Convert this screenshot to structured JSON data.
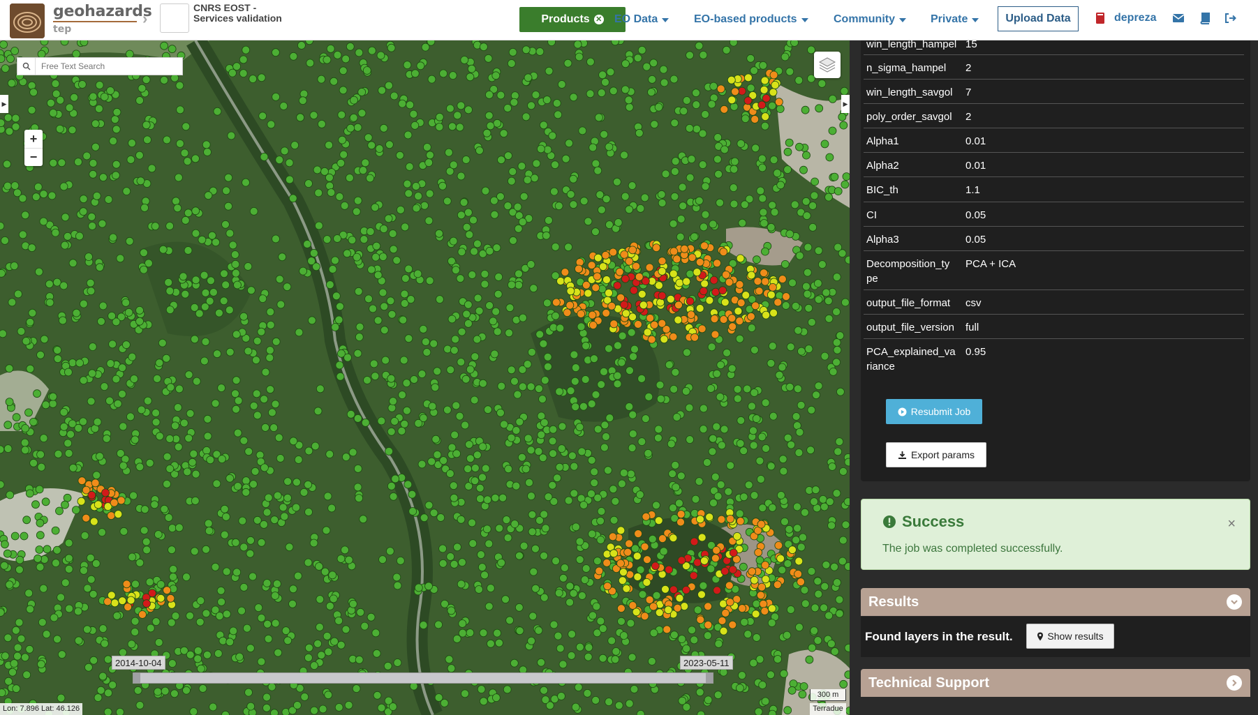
{
  "header": {
    "brand_name": "geohazards",
    "brand_sub": "tep",
    "community_title_line1": "CNRS EOST -",
    "community_title_line2": "Services validation",
    "nav": {
      "products": "Products",
      "eo_data": "EO Data",
      "eo_based_products": "EO-based products",
      "community": "Community",
      "private": "Private"
    },
    "upload_label": "Upload Data",
    "username": "depreza"
  },
  "map": {
    "search_placeholder": "Free Text Search",
    "zoom_in": "+",
    "zoom_out": "−",
    "timeline_start": "2014-10-04",
    "timeline_end": "2023-05-11",
    "coords": "Lon: 7.896 Lat: 46.126",
    "scale": "300 m",
    "attribution": "Terradue"
  },
  "params": {
    "rows": [
      {
        "key": "win_length_hampel",
        "value": "15"
      },
      {
        "key": "n_sigma_hampel",
        "value": "2"
      },
      {
        "key": "win_length_savgol",
        "value": "7"
      },
      {
        "key": "poly_order_savgol",
        "value": "2"
      },
      {
        "key": "Alpha1",
        "value": "0.01"
      },
      {
        "key": "Alpha2",
        "value": "0.01"
      },
      {
        "key": "BIC_th",
        "value": "1.1"
      },
      {
        "key": "CI",
        "value": "0.05"
      },
      {
        "key": "Alpha3",
        "value": "0.05"
      },
      {
        "key": "Decomposition_type",
        "key_line1": "Decomposition_ty",
        "key_line2": "pe",
        "value": "PCA + ICA"
      },
      {
        "key": "output_file_format",
        "value": "csv"
      },
      {
        "key": "output_file_version",
        "value": "full"
      },
      {
        "key": "PCA_explained_variance",
        "key_line1": "PCA_explained_va",
        "key_line2": "riance",
        "value": "0.95"
      }
    ],
    "resubmit_label": "Resubmit Job",
    "export_label": "Export params"
  },
  "alert": {
    "title": "Success",
    "message": "The job was completed successfully.",
    "close": "×"
  },
  "results": {
    "title": "Results",
    "found_text": "Found layers in the result.",
    "show_label": "Show results"
  },
  "support": {
    "title": "Technical Support"
  },
  "colors": {
    "products_green": "#3a7d2c",
    "nav_blue": "#3474a8",
    "accordion_tan": "#b7a193",
    "success_bg": "#dff0d8",
    "resubmit_blue": "#4fb0d8",
    "point_green": "#4caf34",
    "point_yellow": "#d8e21a",
    "point_orange": "#f08c1a",
    "point_red": "#d21a1a"
  }
}
